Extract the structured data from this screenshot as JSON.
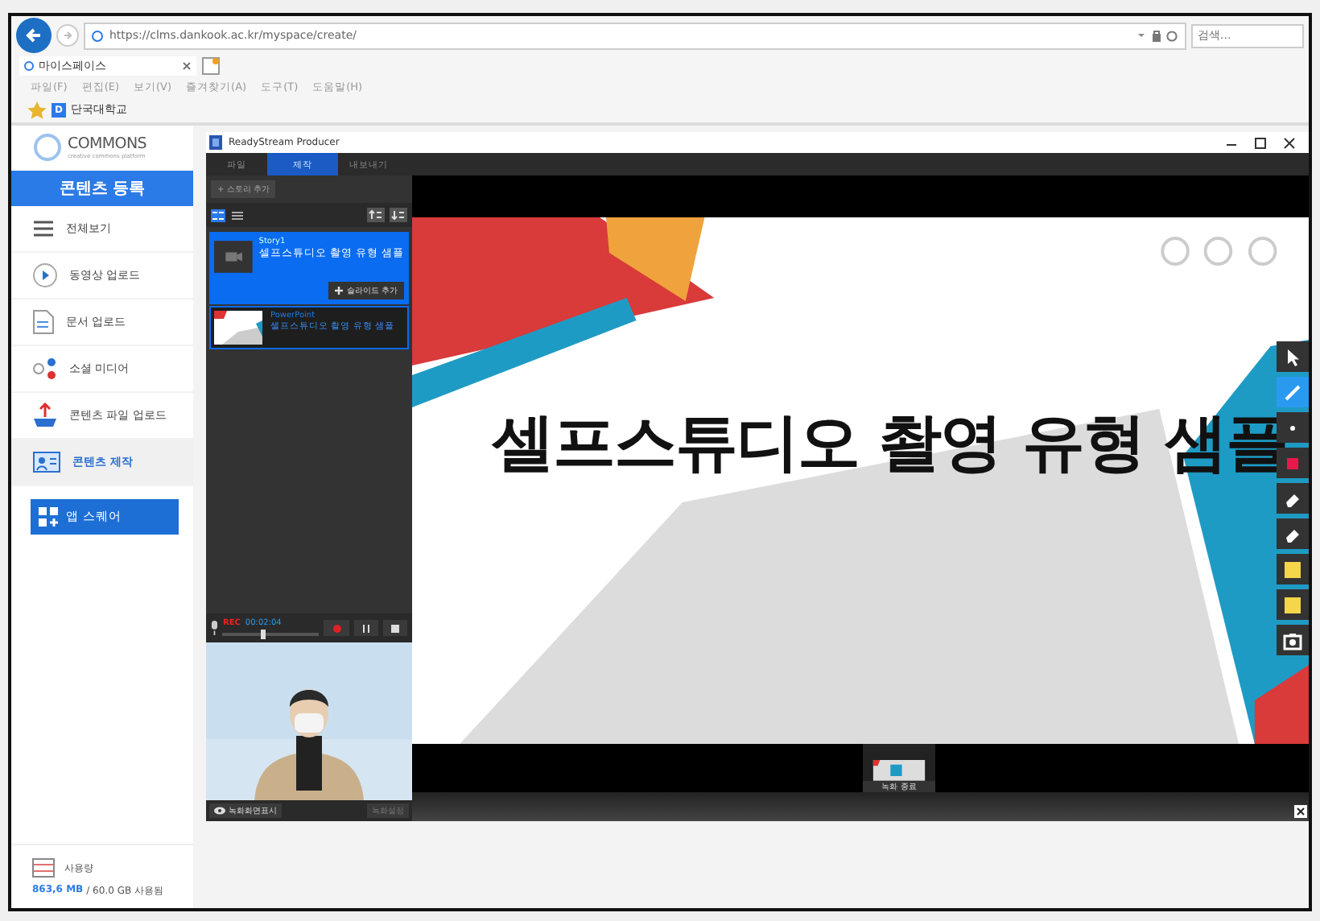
{
  "browser": {
    "url": "https://clms.dankook.ac.kr/myspace/create/",
    "search_placeholder": "검색...",
    "tab_title": "마이스페이스",
    "menu": [
      "파일(F)",
      "편집(E)",
      "보기(V)",
      "즐겨찾기(A)",
      "도구(T)",
      "도움말(H)"
    ],
    "favorites": [
      {
        "icon": "D",
        "label": "단국대학교"
      }
    ]
  },
  "sidebar": {
    "logo": "COMMONS",
    "tagline": "creative commons platform",
    "header": "콘텐츠 등록",
    "items": [
      {
        "kind": "list",
        "label": "전체보기",
        "selected": false
      },
      {
        "kind": "video",
        "label": "동영상 업로드",
        "selected": false
      },
      {
        "kind": "doc",
        "label": "문서 업로드",
        "selected": false
      },
      {
        "kind": "social",
        "label": "소셜 미디어",
        "selected": false
      },
      {
        "kind": "upload",
        "label": "콘텐츠 파일 업로드",
        "selected": false
      },
      {
        "kind": "create",
        "label": "콘텐츠 제작",
        "selected": true
      }
    ],
    "app_button": "앱 스퀘어",
    "usage": {
      "label": "사용량",
      "used": "863,6 MB",
      "total": "/ 60.0 GB 사용됨"
    }
  },
  "producer": {
    "title": "ReadyStream Producer",
    "tabs": [
      {
        "label": "파일",
        "selected": false
      },
      {
        "label": "제작",
        "selected": true
      },
      {
        "label": "내보내기",
        "selected": false
      }
    ],
    "add_story": "+ 스토리 추가",
    "stories": [
      {
        "kind": "story",
        "caption": "Story1",
        "title": "셀프스튜디오 촬영 유형 샘플",
        "selected": true
      },
      {
        "kind": "powerpoint",
        "caption": "PowerPoint",
        "title": "셀프스튜디오 촬영 유형 샘플",
        "selected": false
      }
    ],
    "add_slide": "슬라이드 추가",
    "rec": {
      "label": "REC",
      "time": "00:02:04",
      "level": 0.4
    },
    "show_screen": "녹화화면표시",
    "settings": {
      "label": "녹화설정",
      "disabled": true
    },
    "slide_title": "셀프스튜디오 촬영 유형 샘플",
    "tools": [
      {
        "kind": "cursor",
        "selected": false
      },
      {
        "kind": "pen",
        "selected": true
      },
      {
        "kind": "dot",
        "selected": false
      },
      {
        "kind": "square",
        "selected": false
      },
      {
        "kind": "eraser",
        "selected": false
      },
      {
        "kind": "eraser",
        "selected": false
      },
      {
        "kind": "note",
        "selected": false
      },
      {
        "kind": "note",
        "selected": false
      },
      {
        "kind": "camera",
        "selected": false
      }
    ],
    "end_record": "녹화 종료"
  }
}
